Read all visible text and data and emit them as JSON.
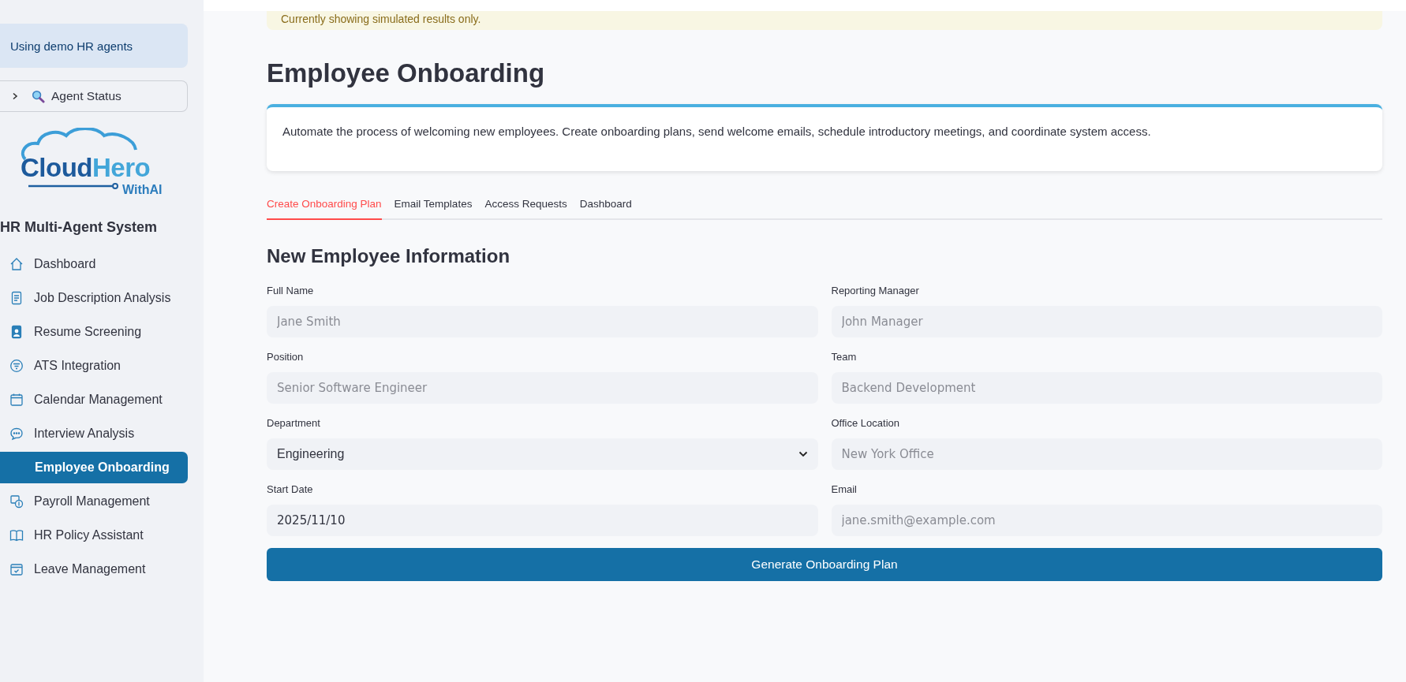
{
  "sidebar": {
    "notice": "Using demo HR agents",
    "agent_status": {
      "label": "Agent Status",
      "expanded": false
    },
    "logo": {
      "main_a": "Cloud",
      "main_b": "Hero",
      "sub": "WithAI"
    },
    "title": "HR Multi-Agent System",
    "items": [
      {
        "label": "Dashboard",
        "selected": false
      },
      {
        "label": "Job Description Analysis",
        "selected": false
      },
      {
        "label": "Resume Screening",
        "selected": false
      },
      {
        "label": "ATS Integration",
        "selected": false
      },
      {
        "label": "Calendar Management",
        "selected": false
      },
      {
        "label": "Interview Analysis",
        "selected": false
      },
      {
        "label": "Employee Onboarding",
        "selected": true
      },
      {
        "label": "Payroll Management",
        "selected": false
      },
      {
        "label": "HR Policy Assistant",
        "selected": false
      },
      {
        "label": "Leave Management",
        "selected": false
      }
    ]
  },
  "banner": {
    "text": "Currently showing simulated results only."
  },
  "page": {
    "title": "Employee Onboarding",
    "description": "Automate the process of welcoming new employees. Create onboarding plans, send welcome emails, schedule introductory meetings, and coordinate system access."
  },
  "tabs": [
    {
      "label": "Create Onboarding Plan",
      "selected": true
    },
    {
      "label": "Email Templates",
      "selected": false
    },
    {
      "label": "Access Requests",
      "selected": false
    },
    {
      "label": "Dashboard",
      "selected": false
    }
  ],
  "form": {
    "title": "New Employee Information",
    "fields": [
      {
        "label": "Full Name",
        "kind": "text",
        "placeholder": "Jane Smith"
      },
      {
        "label": "Reporting Manager",
        "kind": "text",
        "placeholder": "John Manager"
      },
      {
        "label": "Position",
        "kind": "text",
        "placeholder": "Senior Software Engineer"
      },
      {
        "label": "Team",
        "kind": "text",
        "placeholder": "Backend Development"
      },
      {
        "label": "Department",
        "kind": "select",
        "value": "Engineering"
      },
      {
        "label": "Office Location",
        "kind": "text",
        "placeholder": "New York Office"
      },
      {
        "label": "Start Date",
        "kind": "date",
        "value": "2025/11/10"
      },
      {
        "label": "Email",
        "kind": "text",
        "placeholder": "jane.smith@example.com"
      }
    ],
    "button": "Generate Onboarding Plan"
  }
}
